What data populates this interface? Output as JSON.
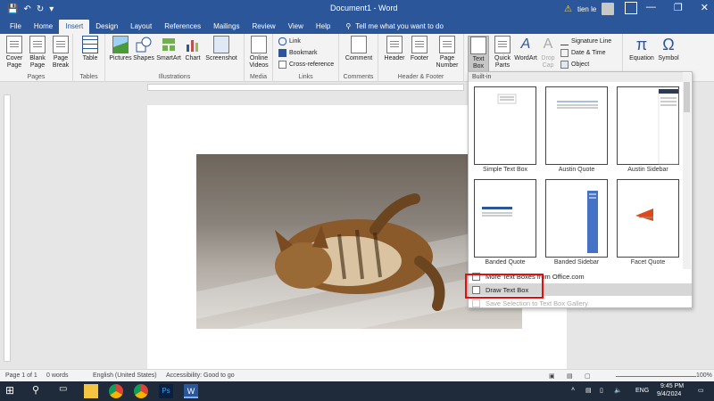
{
  "titlebar": {
    "doc_title": "Document1 - Word",
    "user_name": "tien le"
  },
  "tabs": [
    "File",
    "Home",
    "Insert",
    "Design",
    "Layout",
    "References",
    "Mailings",
    "Review",
    "View",
    "Help"
  ],
  "tell_me": "Tell me what you want to do",
  "ribbon": {
    "pages": {
      "cover": "Cover Page",
      "blank": "Blank Page",
      "break": "Page Break",
      "label": "Pages"
    },
    "tables": {
      "table": "Table",
      "label": "Tables"
    },
    "illustrations": {
      "pictures": "Pictures",
      "shapes": "Shapes",
      "smartart": "SmartArt",
      "chart": "Chart",
      "screenshot": "Screenshot",
      "label": "Illustrations"
    },
    "media": {
      "online_videos": "Online Videos",
      "label": "Media"
    },
    "links": {
      "link": "Link",
      "bookmark": "Bookmark",
      "cross_ref": "Cross-reference",
      "label": "Links"
    },
    "comments": {
      "comment": "Comment",
      "label": "Comments"
    },
    "header_footer": {
      "header": "Header",
      "footer": "Footer",
      "page_number": "Page Number",
      "label": "Header & Footer"
    },
    "text": {
      "text_box": "Text Box",
      "quick_parts": "Quick Parts",
      "wordart": "WordArt",
      "drop_cap": "Drop Cap",
      "signature": "Signature Line",
      "datetime": "Date & Time",
      "object": "Object"
    },
    "symbols": {
      "equation": "Equation",
      "symbol": "Symbol"
    }
  },
  "gallery": {
    "section": "Built-in",
    "thumbs": [
      "Simple Text Box",
      "Austin Quote",
      "Austin Sidebar",
      "Banded Quote",
      "Banded Sidebar",
      "Facet Quote"
    ],
    "more": "More Text Boxes from Office.com",
    "draw": "Draw Text Box",
    "save": "Save Selection to Text Box Gallery"
  },
  "status": {
    "page": "Page 1 of 1",
    "words": "0 words",
    "language": "English (United States)",
    "accessibility": "Accessibility: Good to go",
    "zoom": "100%"
  },
  "taskbar": {
    "lang": "ENG",
    "time": "9:45 PM",
    "date": "9/4/2024"
  },
  "colors": {
    "word_blue": "#2b579a",
    "highlight_red": "#e01010"
  }
}
